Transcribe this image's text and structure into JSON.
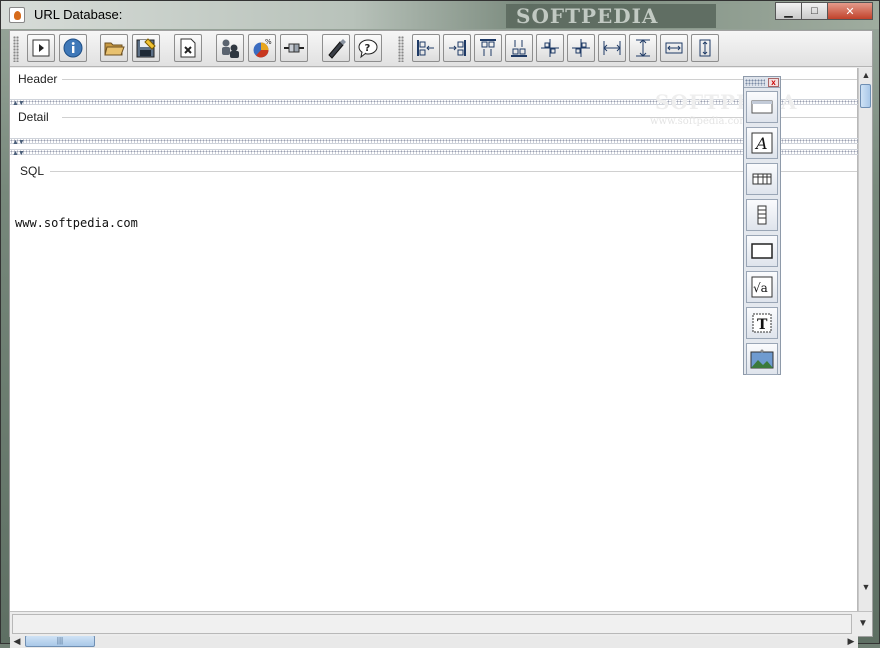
{
  "window": {
    "title": "URL Database:",
    "watermark": "SOFTPEDIA",
    "minimize_label": "▁",
    "maximize_label": "□",
    "close_label": "✕"
  },
  "toolbar": {
    "buttons": [
      {
        "name": "run-icon"
      },
      {
        "name": "info-icon"
      },
      {
        "name": "open-folder-icon"
      },
      {
        "name": "save-icon"
      },
      {
        "name": "report-settings-icon"
      },
      {
        "name": "users-icon"
      },
      {
        "name": "chart-percent-icon"
      },
      {
        "name": "connector-icon"
      },
      {
        "name": "pen-tool-icon"
      },
      {
        "name": "help-icon"
      },
      {
        "name": "align-left-icon"
      },
      {
        "name": "align-right-icon"
      },
      {
        "name": "align-top-icon"
      },
      {
        "name": "align-bottom-icon"
      },
      {
        "name": "center-horizontal-icon"
      },
      {
        "name": "center-vertical-icon"
      },
      {
        "name": "same-width-icon"
      },
      {
        "name": "same-height-icon"
      },
      {
        "name": "space-horizontal-icon"
      },
      {
        "name": "space-vertical-icon"
      }
    ]
  },
  "bands": {
    "header": "Header",
    "detail": "Detail",
    "sql": "SQL"
  },
  "sql_content": "www.softpedia.com",
  "watermark_small": "www.softpedia.com",
  "palette": {
    "close_label": "x",
    "tools": [
      {
        "name": "band-tool-icon"
      },
      {
        "name": "label-tool-icon",
        "glyph": "A"
      },
      {
        "name": "table-tool-icon"
      },
      {
        "name": "column-tool-icon"
      },
      {
        "name": "rectangle-tool-icon"
      },
      {
        "name": "formula-tool-icon",
        "glyph": "√a"
      },
      {
        "name": "text-field-tool-icon",
        "glyph": "T"
      },
      {
        "name": "image-tool-icon"
      }
    ]
  },
  "hscroll_grip": "|||"
}
